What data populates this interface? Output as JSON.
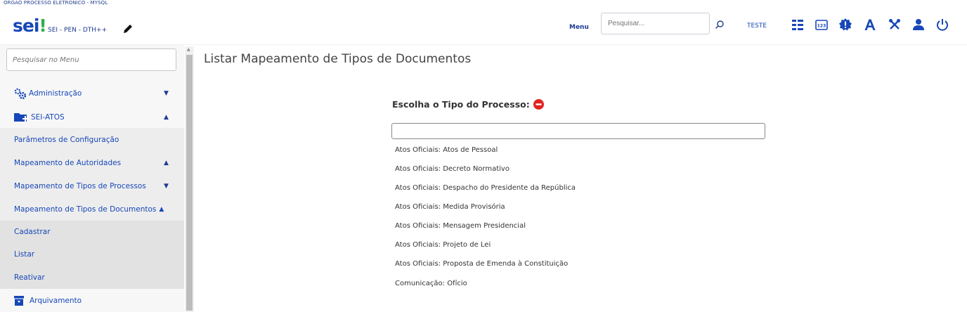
{
  "header": {
    "org_name": "ORGAO PROCESSO ELETRONICO - MYSQL",
    "logo_text": "sei",
    "logo_bang": "!",
    "system_name": "SEI - PEN - DTH++",
    "menu_label": "Menu",
    "search_placeholder": "Pesquisar...",
    "unit_label": "TESTE",
    "icons": [
      "list-view-icon",
      "numbered-badge-icon",
      "certificate-icon",
      "font-size-icon",
      "tools-icon",
      "user-icon",
      "power-icon"
    ],
    "accent_color": "#1747b8"
  },
  "sidebar": {
    "search_placeholder": "Pesquisar no Menu",
    "items": [
      {
        "label": "Administração",
        "icon": "gears-icon"
      },
      {
        "label": "SEI-ATOS",
        "icon": "folder-icon"
      },
      {
        "label": "Parâmetros de Configuração"
      },
      {
        "label": "Mapeamento de Autoridades"
      },
      {
        "label": "Mapeamento de Tipos de Processos"
      },
      {
        "label": "Mapeamento de Tipos de Documentos"
      },
      {
        "label": "Cadastrar"
      },
      {
        "label": "Listar"
      },
      {
        "label": "Reativar"
      },
      {
        "label": "Arquivamento",
        "icon": "archive-icon"
      }
    ]
  },
  "main": {
    "title": "Listar Mapeamento de Tipos de Documentos",
    "choose_label": "Escolha o Tipo do Processo:",
    "options": [
      "Atos Oficiais: Atos de Pessoal",
      "Atos Oficiais: Decreto Normativo",
      "Atos Oficiais: Despacho do Presidente da República",
      "Atos Oficiais: Medida Provisória",
      "Atos Oficiais: Mensagem Presidencial",
      "Atos Oficiais: Projeto de Lei",
      "Atos Oficiais: Proposta de Emenda à Constituição",
      "Comunicação: Ofício"
    ]
  }
}
